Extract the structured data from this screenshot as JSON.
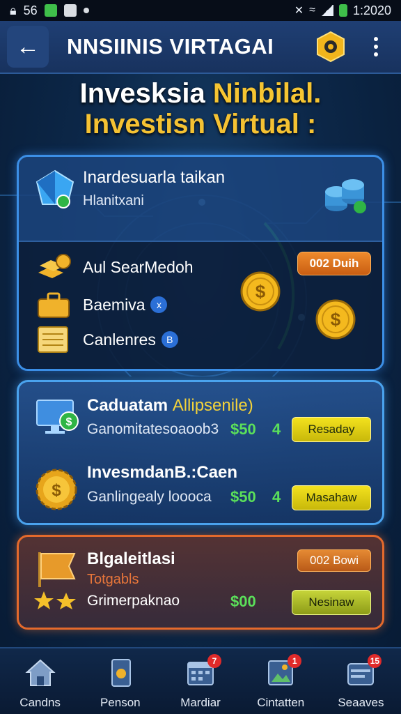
{
  "status_bar": {
    "left_text": "56",
    "time": "1:2020"
  },
  "header": {
    "title": "NNSIINIS VIRTAGAI",
    "back_icon": "arrow-left-icon",
    "logo_icon": "hexagon-logo-icon",
    "menu_icon": "more-vertical-icon"
  },
  "headline": {
    "line1_white": "Invesksia",
    "line1_accent": "Ninbilal.",
    "line2": "Investisn Virtual :"
  },
  "panel1": {
    "title": "Inardesuarla taikan",
    "subtitle": "Hlanitxani",
    "rows": [
      {
        "label": "Aul SearMedoh",
        "icon": "gold-bars-icon"
      },
      {
        "label": "Baemiva",
        "icon": "briefcase-icon",
        "badge": "x"
      },
      {
        "label": "Canlenres",
        "icon": "document-icon",
        "badge": "B"
      }
    ],
    "pill": "002 Duih"
  },
  "panel2": {
    "items": [
      {
        "title": "Caduatam",
        "title_accent": "Allipsenile)",
        "subtitle": "Ganomitatesoaoob3",
        "amount": "$50",
        "count": "4",
        "button": "Resaday",
        "icon": "monitor-dollar-icon"
      },
      {
        "title": "InvesmdanB.:Caen",
        "subtitle": "Ganlingealy loooca",
        "amount": "$50",
        "count": "4",
        "button": "Masahaw",
        "icon": "gear-coin-icon"
      }
    ]
  },
  "panel3": {
    "title": "Blgaleitlasi",
    "subtitle": "Totgabls",
    "label": "Grimerpaknao",
    "amount": "$00",
    "pill": "002 Bowi",
    "button": "Nesinaw",
    "icon": "flag-icon"
  },
  "bottom_nav": [
    {
      "label": "Candns",
      "icon": "home-icon"
    },
    {
      "label": "Penson",
      "icon": "tablet-icon"
    },
    {
      "label": "Mardiar",
      "icon": "calendar-icon",
      "badge": "7"
    },
    {
      "label": "Cintatten",
      "icon": "image-icon",
      "badge": "1"
    },
    {
      "label": "Seaaves",
      "icon": "wallet-icon",
      "badge": "15"
    }
  ],
  "colors": {
    "accent_yellow": "#f5c233",
    "money_green": "#5be05a",
    "panel_blue_border": "#3c8fe6",
    "panel_orange_border": "#e46a2c",
    "badge_red": "#e02a2a"
  }
}
